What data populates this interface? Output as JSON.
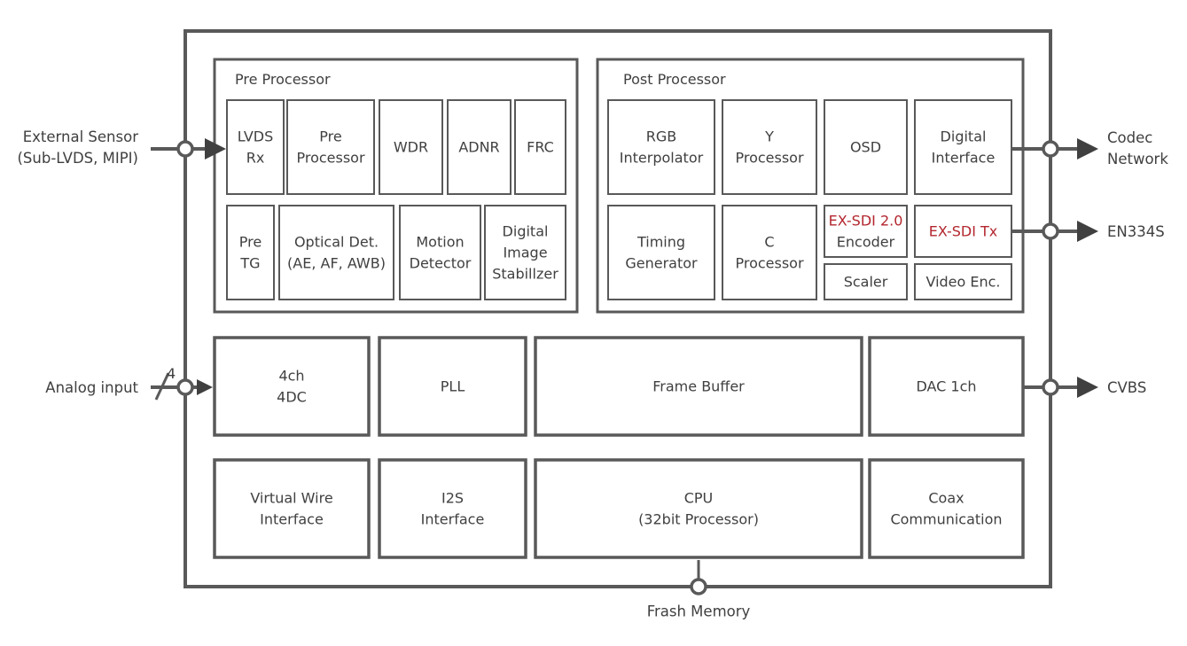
{
  "colors": {
    "line": "#595959",
    "text": "#404040",
    "highlight": "#b3262e",
    "background": "#ffffff"
  },
  "external": {
    "left_top": [
      "External Sensor",
      "(Sub-LVDS, MIPI)"
    ],
    "left_bottom": "Analog input",
    "bus_width": "4",
    "right_top": [
      "Codec",
      "Network"
    ],
    "right_middle": "EN334S",
    "right_bottom": "CVBS",
    "bottom": "Frash Memory"
  },
  "pre_processor": {
    "title": "Pre Processor",
    "row1": [
      {
        "lines": [
          "LVDS",
          "Rx"
        ]
      },
      {
        "lines": [
          "Pre",
          "Processor"
        ]
      },
      {
        "lines": [
          "WDR"
        ]
      },
      {
        "lines": [
          "ADNR"
        ]
      },
      {
        "lines": [
          "FRC"
        ]
      }
    ],
    "row2": [
      {
        "lines": [
          "Pre",
          "TG"
        ]
      },
      {
        "lines": [
          "Optical Det.",
          "(AE, AF, AWB)"
        ]
      },
      {
        "lines": [
          "Motion",
          "Detector"
        ]
      },
      {
        "lines": [
          "Digital",
          "Image",
          "Stabillzer"
        ]
      }
    ]
  },
  "post_processor": {
    "title": "Post Processor",
    "row1": [
      {
        "lines": [
          "RGB",
          "Interpolator"
        ]
      },
      {
        "lines": [
          "Y",
          "Processor"
        ]
      },
      {
        "lines": [
          "OSD"
        ]
      },
      {
        "lines": [
          "Digital",
          "Interface"
        ]
      }
    ],
    "row2": [
      {
        "lines": [
          "Timing",
          "Generator"
        ]
      },
      {
        "lines": [
          "C",
          "Processor"
        ]
      },
      {
        "lines": [
          "EX-SDI 2.0",
          "Encoder"
        ],
        "highlight_line": 0
      },
      {
        "lines": [
          "EX-SDI Tx"
        ],
        "highlight_line": 0
      },
      {
        "lines": [
          "Scaler"
        ]
      },
      {
        "lines": [
          "Video Enc."
        ]
      }
    ]
  },
  "middle_row": [
    {
      "lines": [
        "4ch",
        "4DC"
      ]
    },
    {
      "lines": [
        "PLL"
      ]
    },
    {
      "lines": [
        "Frame Buffer"
      ]
    },
    {
      "lines": [
        "DAC 1ch"
      ]
    }
  ],
  "bottom_row": [
    {
      "lines": [
        "Virtual Wire",
        "Interface"
      ]
    },
    {
      "lines": [
        "I2S",
        "Interface"
      ]
    },
    {
      "lines": [
        "CPU",
        "(32bit Processor)"
      ]
    },
    {
      "lines": [
        "Coax",
        "Communication"
      ]
    }
  ]
}
